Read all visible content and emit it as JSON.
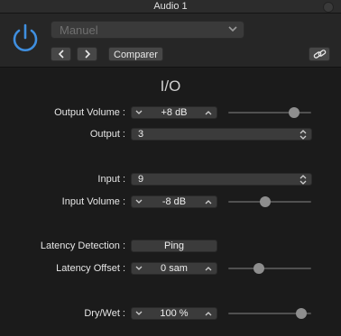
{
  "window": {
    "title": "Audio 1"
  },
  "header": {
    "preset_value": "Manuel",
    "compare_label": "Comparer"
  },
  "section_title": "I/O",
  "rows": {
    "output_volume": {
      "label": "Output Volume :",
      "value": "+8  dB",
      "slider_fraction": 0.84
    },
    "output": {
      "label": "Output :",
      "value": "3"
    },
    "input": {
      "label": "Input :",
      "value": "9"
    },
    "input_volume": {
      "label": "Input Volume :",
      "value": "-8  dB",
      "slider_fraction": 0.44
    },
    "latency_detection": {
      "label": "Latency Detection :",
      "button": "Ping"
    },
    "latency_offset": {
      "label": "Latency Offset :",
      "value": "0  sam",
      "slider_fraction": 0.35
    },
    "dry_wet": {
      "label": "Dry/Wet :",
      "value": "100  %",
      "slider_fraction": 0.94
    }
  },
  "colors": {
    "power_accent": "#3f8fe0",
    "background": "#1b1b1b",
    "control": "#3b3b3b"
  },
  "icons": [
    "power-icon",
    "chevron-down-icon",
    "chevron-left-icon",
    "chevron-right-icon",
    "link-icon",
    "close-icon"
  ]
}
